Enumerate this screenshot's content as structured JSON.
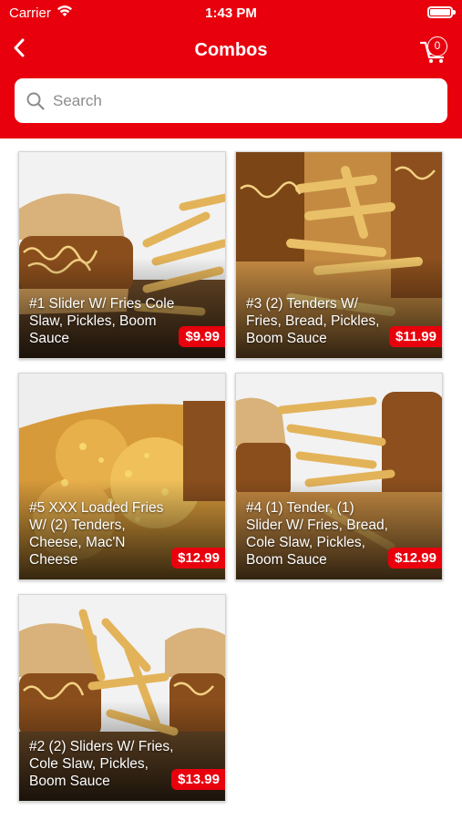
{
  "status_bar": {
    "carrier": "Carrier",
    "time": "1:43 PM"
  },
  "nav": {
    "title": "Combos",
    "cart_count": "0"
  },
  "search": {
    "placeholder": "Search"
  },
  "colors": {
    "brand_red": "#e8000d",
    "white": "#ffffff"
  },
  "combos": [
    {
      "name": "#1 Slider W/ Fries Cole Slaw, Pickles, Boom Sauce",
      "price": "$9.99"
    },
    {
      "name": "#3 (2) Tenders W/ Fries, Bread, Pickles, Boom Sauce",
      "price": "$11.99"
    },
    {
      "name": "#5 XXX Loaded Fries W/ (2) Tenders, Cheese, Mac'N Cheese",
      "price": "$12.99"
    },
    {
      "name": "#4 (1) Tender, (1) Slider W/ Fries, Bread, Cole Slaw, Pickles, Boom Sauce",
      "price": "$12.99"
    },
    {
      "name": "#2 (2) Sliders W/ Fries, Cole Slaw, Pickles, Boom Sauce",
      "price": "$13.99"
    }
  ]
}
